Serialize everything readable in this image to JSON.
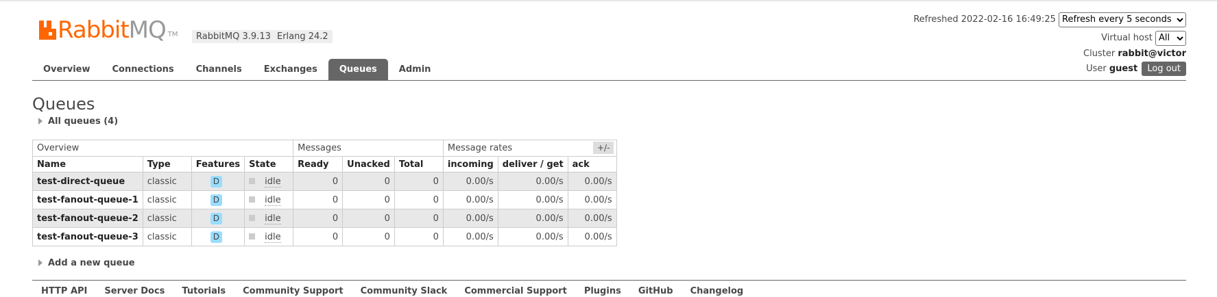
{
  "header": {
    "logo_text_rabbit": "Rabbit",
    "logo_text_mq": "MQ",
    "logo_tm": "TM",
    "rabbitmq_version": "RabbitMQ 3.9.13",
    "erlang_version": "Erlang 24.2",
    "refreshed_label": "Refreshed 2022-02-16 16:49:25",
    "refresh_select_value": "Refresh every 5 seconds",
    "virtual_host_label": "Virtual host",
    "virtual_host_value": "All",
    "cluster_label": "Cluster",
    "cluster_value": "rabbit@victor",
    "user_label": "User",
    "user_value": "guest",
    "logout_label": "Log out"
  },
  "tabs": [
    "Overview",
    "Connections",
    "Channels",
    "Exchanges",
    "Queues",
    "Admin"
  ],
  "active_tab": "Queues",
  "page": {
    "title": "Queues",
    "all_queues_toggle": "All queues (4)",
    "add_queue_toggle": "Add a new queue",
    "columns_toggle": "+/-"
  },
  "table": {
    "groups": [
      "Overview",
      "Messages",
      "Message rates"
    ],
    "columns": [
      "Name",
      "Type",
      "Features",
      "State",
      "Ready",
      "Unacked",
      "Total",
      "incoming",
      "deliver / get",
      "ack"
    ],
    "rows": [
      {
        "name": "test-direct-queue",
        "type": "classic",
        "features": "D",
        "state": "idle",
        "ready": "0",
        "unacked": "0",
        "total": "0",
        "incoming": "0.00/s",
        "deliver": "0.00/s",
        "ack": "0.00/s"
      },
      {
        "name": "test-fanout-queue-1",
        "type": "classic",
        "features": "D",
        "state": "idle",
        "ready": "0",
        "unacked": "0",
        "total": "0",
        "incoming": "0.00/s",
        "deliver": "0.00/s",
        "ack": "0.00/s"
      },
      {
        "name": "test-fanout-queue-2",
        "type": "classic",
        "features": "D",
        "state": "idle",
        "ready": "0",
        "unacked": "0",
        "total": "0",
        "incoming": "0.00/s",
        "deliver": "0.00/s",
        "ack": "0.00/s"
      },
      {
        "name": "test-fanout-queue-3",
        "type": "classic",
        "features": "D",
        "state": "idle",
        "ready": "0",
        "unacked": "0",
        "total": "0",
        "incoming": "0.00/s",
        "deliver": "0.00/s",
        "ack": "0.00/s"
      }
    ]
  },
  "footer": [
    "HTTP API",
    "Server Docs",
    "Tutorials",
    "Community Support",
    "Community Slack",
    "Commercial Support",
    "Plugins",
    "GitHub",
    "Changelog"
  ],
  "colors": {
    "brand_orange": "#ff6600",
    "tab_active": "#666666",
    "feature_badge": "#99ddff"
  }
}
